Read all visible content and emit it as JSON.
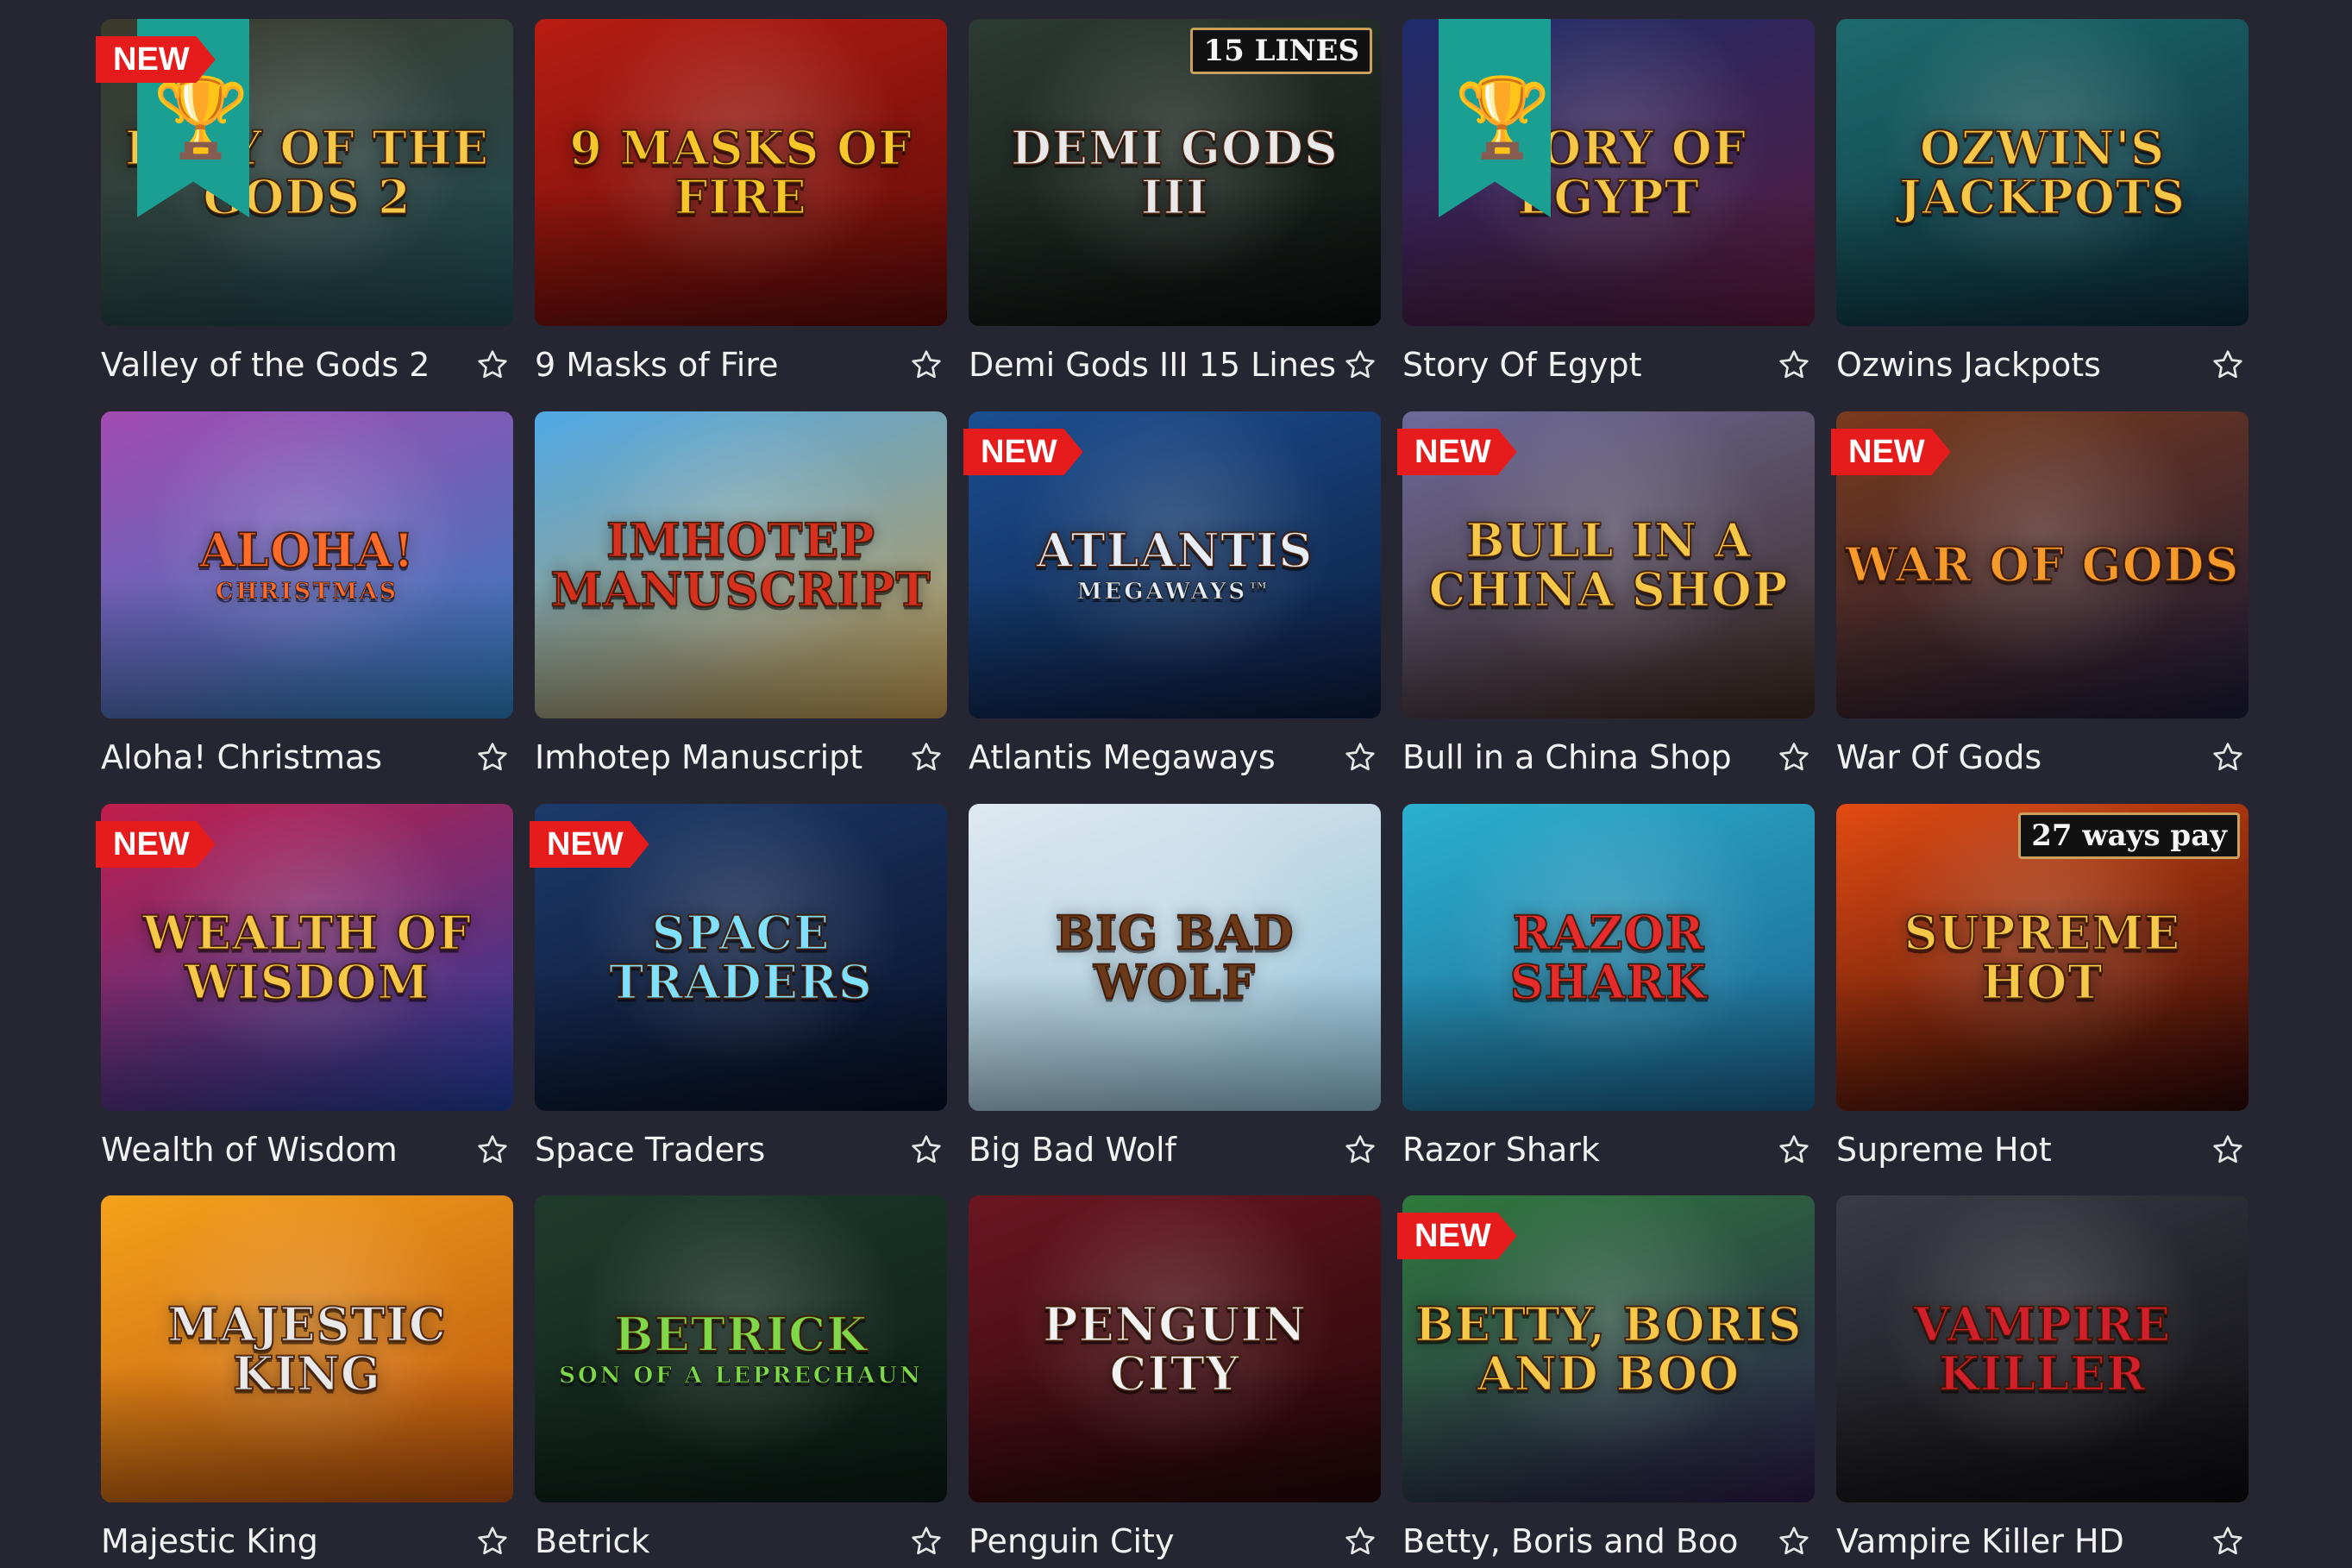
{
  "badge_new_label": "NEW",
  "games": [
    {
      "title": "Valley of the Gods 2",
      "art": "LLEY OF THE GODS 2",
      "art_sub": "",
      "new": true,
      "trophy": true,
      "bg1": "#3b3a2c",
      "bg2": "#1e4b52",
      "fg": "#f5c84a"
    },
    {
      "title": "9 Masks of Fire",
      "art": "9 MASKS OF FIRE",
      "art_sub": "",
      "new": false,
      "trophy": false,
      "bg1": "#b81d12",
      "bg2": "#5a0b08",
      "fg": "#f7c62b"
    },
    {
      "title": "Demi Gods III 15 Lines",
      "art": "DEMI GODS III",
      "art_sub": "",
      "new": false,
      "trophy": false,
      "bg1": "#2c3b33",
      "bg2": "#0b0f0d",
      "fg": "#e9e9e9",
      "tag": "15 LINES"
    },
    {
      "title": "Story Of Egypt",
      "art": "STORY OF EGYPT",
      "art_sub": "",
      "new": false,
      "trophy": true,
      "bg1": "#1d2c6b",
      "bg2": "#5a1a3b",
      "fg": "#f5c84a"
    },
    {
      "title": "Ozwins Jackpots",
      "art": "OZWIN'S JACKPOTS",
      "art_sub": "",
      "new": false,
      "trophy": false,
      "bg1": "#1d6b6e",
      "bg2": "#0d2b3b",
      "fg": "#f5c84a"
    },
    {
      "title": "Aloha! Christmas",
      "art": "Aloha!",
      "art_sub": "CHRISTMAS",
      "new": false,
      "trophy": false,
      "bg1": "#a34bb1",
      "bg2": "#2b7fbf",
      "fg": "#ff6b2a"
    },
    {
      "title": "Imhotep Manuscript",
      "art": "Imhotep Manuscript",
      "art_sub": "",
      "new": false,
      "trophy": false,
      "bg1": "#4fa9e6",
      "bg2": "#c79a4d",
      "fg": "#d6311f"
    },
    {
      "title": "Atlantis Megaways",
      "art": "ATLANTIS",
      "art_sub": "MEGAWAYS™",
      "new": true,
      "trophy": false,
      "bg1": "#1b4f91",
      "bg2": "#0c1b3c",
      "fg": "#e6eef9"
    },
    {
      "title": "Bull in a China Shop",
      "art": "BULL IN A CHINA SHOP",
      "art_sub": "",
      "new": true,
      "trophy": false,
      "bg1": "#6e6a9a",
      "bg2": "#3b2a1f",
      "fg": "#f5c84a"
    },
    {
      "title": "War Of Gods",
      "art": "WAR OF GODS",
      "art_sub": "",
      "new": true,
      "trophy": false,
      "bg1": "#7a3a1d",
      "bg2": "#1b1b35",
      "fg": "#f59a2b"
    },
    {
      "title": "Wealth of Wisdom",
      "art": "WEALTH OF WISDOM",
      "art_sub": "",
      "new": true,
      "trophy": false,
      "bg1": "#c21d4b",
      "bg2": "#1f3fa0",
      "fg": "#f5c84a"
    },
    {
      "title": "Space Traders",
      "art": "SPACE TRADERS",
      "art_sub": "",
      "new": true,
      "trophy": false,
      "bg1": "#1d3a6b",
      "bg2": "#071025",
      "fg": "#7fe1ff"
    },
    {
      "title": "Big Bad Wolf",
      "art": "BIG BAD WOLF",
      "art_sub": "",
      "new": false,
      "trophy": false,
      "bg1": "#dfe9f0",
      "bg2": "#8fbfd8",
      "fg": "#6b3a1b"
    },
    {
      "title": "Razor Shark",
      "art": "RAZOR SHARK",
      "art_sub": "",
      "new": false,
      "trophy": false,
      "bg1": "#2bb0cf",
      "bg2": "#1b5f8a",
      "fg": "#e52b2b"
    },
    {
      "title": "Supreme Hot",
      "art": "SUPREME HOT",
      "art_sub": "",
      "new": false,
      "trophy": false,
      "bg1": "#e34b12",
      "bg2": "#2b0808",
      "fg": "#f5c84a",
      "tag": "27 ways pay"
    },
    {
      "title": "Majestic King",
      "art": "MAJESTIC KING",
      "art_sub": "",
      "new": false,
      "trophy": false,
      "bg1": "#f5a21b",
      "bg2": "#b8500d",
      "fg": "#e9e9e9"
    },
    {
      "title": "Betrick",
      "art": "BETRICK",
      "art_sub": "Son of a Leprechaun",
      "new": false,
      "trophy": false,
      "bg1": "#1f3b2c",
      "bg2": "#0a1a14",
      "fg": "#7fd84a"
    },
    {
      "title": "Penguin City",
      "art": "PENGUIN CITY",
      "art_sub": "",
      "new": false,
      "trophy": false,
      "bg1": "#6b1620",
      "bg2": "#220608",
      "fg": "#f2f2f2"
    },
    {
      "title": "Betty, Boris and Boo",
      "art": "BETTY, BORIS AND BOO",
      "art_sub": "",
      "new": true,
      "trophy": false,
      "bg1": "#2e7a3b",
      "bg2": "#2b1b4b",
      "fg": "#f5c84a"
    },
    {
      "title": "Vampire Killer HD",
      "art": "VAMPIRE KILLER",
      "art_sub": "",
      "new": false,
      "trophy": false,
      "bg1": "#3b3b45",
      "bg2": "#0c0c10",
      "fg": "#d11f2b"
    }
  ]
}
